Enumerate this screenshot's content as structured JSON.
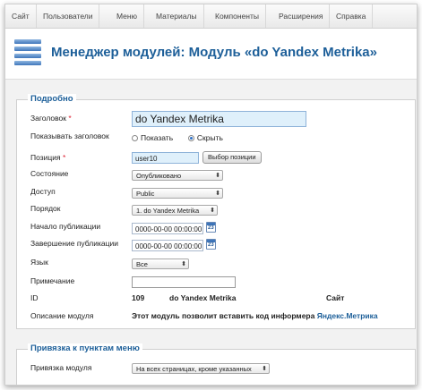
{
  "menu": [
    "Сайт",
    "Пользователи",
    "Меню",
    "Материалы",
    "Компоненты",
    "Расширения",
    "Справка"
  ],
  "page_title": "Менеджер модулей: Модуль «do Yandex Metrika»",
  "details": {
    "legend": "Подробно",
    "title_label": "Заголовок",
    "title_value": "do Yandex Metrika",
    "show_title_label": "Показывать заголовок",
    "show_option": "Показать",
    "hide_option": "Скрыть",
    "position_label": "Позиция",
    "position_value": "user10",
    "position_button": "Выбор позиции",
    "state_label": "Состояние",
    "state_value": "Опубликовано",
    "access_label": "Доступ",
    "access_value": "Public",
    "order_label": "Порядок",
    "order_value": "1. do Yandex Metrika",
    "publish_up_label": "Начало публикации",
    "publish_up_value": "0000-00-00 00:00:00",
    "publish_down_label": "Завершение публикации",
    "publish_down_value": "0000-00-00 00:00:00",
    "calendar_day": "23",
    "language_label": "Язык",
    "language_value": "Все",
    "note_label": "Примечание",
    "note_value": "",
    "id_label": "ID",
    "id_value": "109",
    "module_name": "do Yandex Metrika",
    "client": "Сайт",
    "desc_label": "Описание модуля",
    "desc_text": "Этот модуль позволит вставить код информера",
    "desc_link": "Яндекс.Метрика"
  },
  "assignment": {
    "legend": "Привязка к пунктам меню",
    "label": "Привязка модуля",
    "value": "На всех страницах, кроме указанных"
  }
}
